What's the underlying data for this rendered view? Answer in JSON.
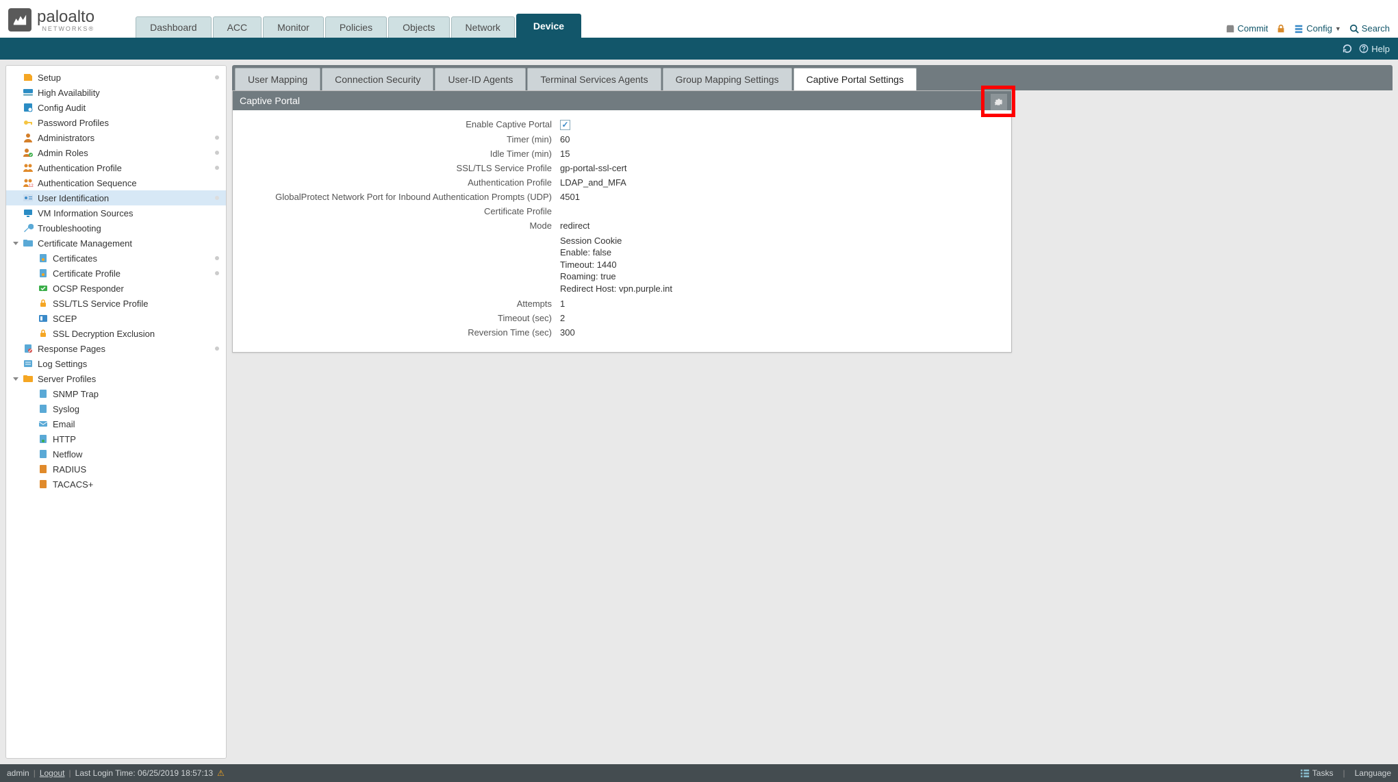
{
  "colors": {
    "primary": "#12566a",
    "tabInactive": "#cfe0e2",
    "panelHeader": "#717b80",
    "highlight": "#ff0000"
  },
  "logo": {
    "name": "paloalto",
    "sub": "NETWORKS®"
  },
  "mainTabs": [
    {
      "label": "Dashboard",
      "active": false
    },
    {
      "label": "ACC",
      "active": false
    },
    {
      "label": "Monitor",
      "active": false
    },
    {
      "label": "Policies",
      "active": false
    },
    {
      "label": "Objects",
      "active": false
    },
    {
      "label": "Network",
      "active": false
    },
    {
      "label": "Device",
      "active": true
    }
  ],
  "topActions": {
    "commit": "Commit",
    "config": "Config",
    "search": "Search"
  },
  "helpBar": {
    "help": "Help"
  },
  "sidebar": {
    "items": [
      {
        "label": "Setup",
        "level": 1,
        "color": "#f5a623"
      },
      {
        "label": "High Availability",
        "level": 1,
        "color": "#2b8cc4"
      },
      {
        "label": "Config Audit",
        "level": 1,
        "color": "#2b8cc4"
      },
      {
        "label": "Password Profiles",
        "level": 1,
        "color": "#f5c542"
      },
      {
        "label": "Administrators",
        "level": 1,
        "dot": true,
        "color": "#d47f2a"
      },
      {
        "label": "Admin Roles",
        "level": 1,
        "dot": true,
        "color": "#3aae49"
      },
      {
        "label": "Authentication Profile",
        "level": 1,
        "dot": true,
        "color": "#e08a2b"
      },
      {
        "label": "Authentication Sequence",
        "level": 1,
        "color": "#e08a2b"
      },
      {
        "label": "User Identification",
        "level": 1,
        "selected": true,
        "color": "#3a8ac8"
      },
      {
        "label": "VM Information Sources",
        "level": 1,
        "color": "#2b8cc4"
      },
      {
        "label": "Troubleshooting",
        "level": 1,
        "color": "#5aa9d6"
      },
      {
        "label": "Certificate Management",
        "level": 1,
        "parent": true,
        "color": "#5aa9d6"
      },
      {
        "label": "Certificates",
        "level": 2,
        "dot": true,
        "color": "#5aa9d6"
      },
      {
        "label": "Certificate Profile",
        "level": 2,
        "dot": true,
        "color": "#5aa9d6"
      },
      {
        "label": "OCSP Responder",
        "level": 2,
        "color": "#3aae49"
      },
      {
        "label": "SSL/TLS Service Profile",
        "level": 2,
        "color": "#f5a623"
      },
      {
        "label": "SCEP",
        "level": 2,
        "color": "#3a8ac8"
      },
      {
        "label": "SSL Decryption Exclusion",
        "level": 2,
        "color": "#f5a623"
      },
      {
        "label": "Response Pages",
        "level": 1,
        "dot": true,
        "color": "#d9534f"
      },
      {
        "label": "Log Settings",
        "level": 1,
        "color": "#5aa9d6"
      },
      {
        "label": "Server Profiles",
        "level": 1,
        "parent": true,
        "color": "#f5a623"
      },
      {
        "label": "SNMP Trap",
        "level": 2,
        "color": "#5aa9d6"
      },
      {
        "label": "Syslog",
        "level": 2,
        "color": "#5aa9d6"
      },
      {
        "label": "Email",
        "level": 2,
        "color": "#5aa9d6"
      },
      {
        "label": "HTTP",
        "level": 2,
        "color": "#5aa9d6"
      },
      {
        "label": "Netflow",
        "level": 2,
        "color": "#5aa9d6"
      },
      {
        "label": "RADIUS",
        "level": 2,
        "color": "#e08a2b"
      },
      {
        "label": "TACACS+",
        "level": 2,
        "color": "#e08a2b"
      }
    ]
  },
  "subTabs": [
    {
      "label": "User Mapping",
      "active": false
    },
    {
      "label": "Connection Security",
      "active": false
    },
    {
      "label": "User-ID Agents",
      "active": false
    },
    {
      "label": "Terminal Services Agents",
      "active": false
    },
    {
      "label": "Group Mapping Settings",
      "active": false
    },
    {
      "label": "Captive Portal Settings",
      "active": true
    }
  ],
  "panel": {
    "title": "Captive Portal",
    "fields": {
      "enable_label": "Enable Captive Portal",
      "enable_value": true,
      "timer_label": "Timer (min)",
      "timer_value": "60",
      "idle_label": "Idle Timer (min)",
      "idle_value": "15",
      "ssl_label": "SSL/TLS Service Profile",
      "ssl_value": "gp-portal-ssl-cert",
      "auth_label": "Authentication Profile",
      "auth_value": "LDAP_and_MFA",
      "gp_label": "GlobalProtect Network Port for Inbound Authentication Prompts (UDP)",
      "gp_value": "4501",
      "certprof_label": "Certificate Profile",
      "certprof_value": "",
      "mode_label": "Mode",
      "mode_value": "redirect",
      "session_l1": "Session Cookie",
      "session_l2": "Enable: false",
      "session_l3": "Timeout: 1440",
      "session_l4": "Roaming: true",
      "session_l5": "Redirect Host: vpn.purple.int",
      "attempts_label": "Attempts",
      "attempts_value": "1",
      "timeout_label": "Timeout (sec)",
      "timeout_value": "2",
      "reversion_label": "Reversion Time (sec)",
      "reversion_value": "300"
    }
  },
  "footer": {
    "user": "admin",
    "logout": "Logout",
    "lastLogin": "Last Login Time: 06/25/2019 18:57:13",
    "tasks": "Tasks",
    "language": "Language"
  }
}
